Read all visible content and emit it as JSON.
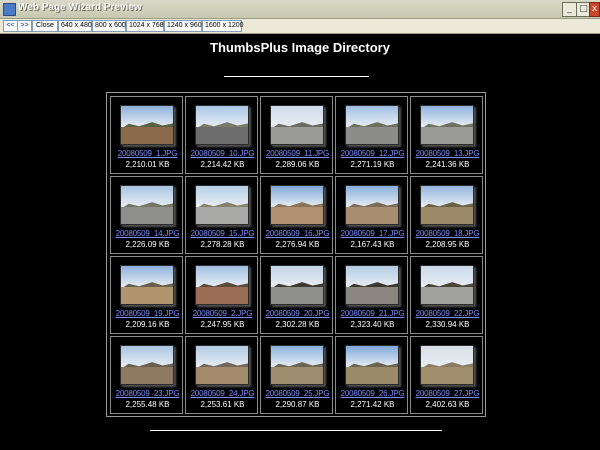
{
  "window": {
    "title": "Web Page Wizard Preview"
  },
  "toolbar": {
    "back_label": "<<",
    "forward_label": ">>",
    "close_label": "Close",
    "sizes": [
      "640 x 480",
      "800 x 600",
      "1024 x 768",
      "1240 x 960",
      "1600 x 1200"
    ]
  },
  "page": {
    "title": "ThumbsPlus Image Directory"
  },
  "thumbnails": [
    {
      "name": "20080509_1.JPG",
      "size": "2,210.01 KB",
      "sky": "#8db0d8",
      "ground": "#8a6a4a",
      "hill": "#5a6040"
    },
    {
      "name": "20080509_10.JPG",
      "size": "2,214.42 KB",
      "sky": "#a9c6e6",
      "ground": "#6c6c6c",
      "hill": "#7a7a68"
    },
    {
      "name": "20080509_11.JPG",
      "size": "2,289.06 KB",
      "sky": "#cfdceb",
      "ground": "#9a9a98",
      "hill": "#6a6e60"
    },
    {
      "name": "20080509_12.JPG",
      "size": "2,271.19 KB",
      "sky": "#9fc0e4",
      "ground": "#8c8c8a",
      "hill": "#6e705c"
    },
    {
      "name": "20080509_13.JPG",
      "size": "2,241.36 KB",
      "sky": "#8fb4de",
      "ground": "#9a9a96",
      "hill": "#707062"
    },
    {
      "name": "20080509_14.JPG",
      "size": "2,226.09 KB",
      "sky": "#a8c4e2",
      "ground": "#8e8e8c",
      "hill": "#757565"
    },
    {
      "name": "20080509_15.JPG",
      "size": "2,278.28 KB",
      "sky": "#b6cfe6",
      "ground": "#a8a8a6",
      "hill": "#86806c"
    },
    {
      "name": "20080509_16.JPG",
      "size": "2,276.94 KB",
      "sky": "#7fa9da",
      "ground": "#b09070",
      "hill": "#8a7458"
    },
    {
      "name": "20080509_17.JPG",
      "size": "2,167.43 KB",
      "sky": "#88aedc",
      "ground": "#a88e70",
      "hill": "#7c6c56"
    },
    {
      "name": "20080509_18.JPG",
      "size": "2,208.95 KB",
      "sky": "#94b6de",
      "ground": "#9c8a68",
      "hill": "#6c6048"
    },
    {
      "name": "20080509_19.JPG",
      "size": "2,209.16 KB",
      "sky": "#8fb1dc",
      "ground": "#b0956e",
      "hill": "#6a5e4c"
    },
    {
      "name": "20080509_2.JPG",
      "size": "2,247.95 KB",
      "sky": "#a0c0e4",
      "ground": "#9a6e56",
      "hill": "#5c4a3a"
    },
    {
      "name": "20080509_20.JPG",
      "size": "2,302.28 KB",
      "sky": "#c2d4e8",
      "ground": "#8e8e8a",
      "hill": "#3e3a30"
    },
    {
      "name": "20080509_21.JPG",
      "size": "2,323.40 KB",
      "sky": "#b4cce4",
      "ground": "#8a8680",
      "hill": "#3c3830"
    },
    {
      "name": "20080509_22.JPG",
      "size": "2,330.94 KB",
      "sky": "#c8d8ea",
      "ground": "#a0a09c",
      "hill": "#4a4436"
    },
    {
      "name": "20080509_23.JPG",
      "size": "2,255.48 KB",
      "sky": "#aac4e2",
      "ground": "#8e7a62",
      "hill": "#6a6050"
    },
    {
      "name": "20080509_24.JPG",
      "size": "2,253.61 KB",
      "sky": "#b2cae4",
      "ground": "#a48a6c",
      "hill": "#74685a"
    },
    {
      "name": "20080509_25.JPG",
      "size": "2,290.87 KB",
      "sky": "#8cb2de",
      "ground": "#9c8c6e",
      "hill": "#6a6654"
    },
    {
      "name": "20080509_26.JPG",
      "size": "2,271.42 KB",
      "sky": "#7ea8da",
      "ground": "#9a8a6a",
      "hill": "#6c6450"
    },
    {
      "name": "20080509_27.JPG",
      "size": "2,402.63 KB",
      "sky": "#d6dde4",
      "ground": "#a08e6e",
      "hill": "#8a7c64"
    }
  ],
  "colors": {
    "background": "#000000",
    "link": "#7b8cff",
    "text": "#ffffff"
  }
}
